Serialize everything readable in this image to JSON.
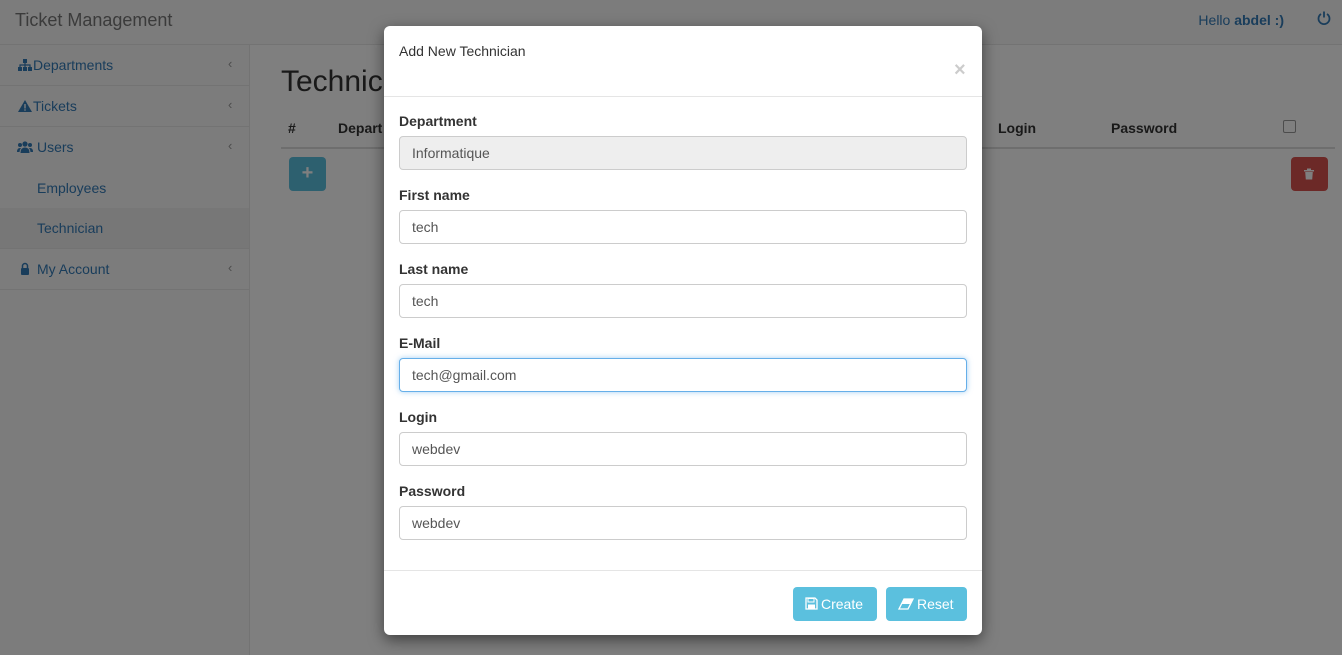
{
  "navbar": {
    "brand": "Ticket Management",
    "greeting": "Hello",
    "username": "abdel :)",
    "power_icon": "power-icon"
  },
  "sidebar": {
    "items": [
      {
        "label": "Departments",
        "icon": "sitemap-icon"
      },
      {
        "label": "Tickets",
        "icon": "warning-icon"
      },
      {
        "label": "Users",
        "icon": "users-icon"
      },
      {
        "label": "Employees"
      },
      {
        "label": "Technician"
      },
      {
        "label": "My Account",
        "icon": "lock-icon"
      }
    ],
    "chevron": "‹"
  },
  "main": {
    "title": "Technic",
    "columns": [
      "#",
      "Depart",
      "Login",
      "Password"
    ],
    "add_label": "+"
  },
  "modal": {
    "title": "Add New Technician",
    "close": "×",
    "fields": {
      "department": {
        "label": "Department",
        "value": "Informatique"
      },
      "first_name": {
        "label": "First name",
        "value": "tech"
      },
      "last_name": {
        "label": "Last name",
        "value": "tech"
      },
      "email": {
        "label": "E-Mail",
        "value": "tech@gmail.com"
      },
      "login": {
        "label": "Login",
        "value": "webdev"
      },
      "password": {
        "label": "Password",
        "value": "webdev"
      }
    },
    "buttons": {
      "create": "Create",
      "reset": "Reset"
    }
  },
  "colors": {
    "accent": "#337ab7",
    "info": "#5bc0de",
    "danger": "#d9534f"
  }
}
